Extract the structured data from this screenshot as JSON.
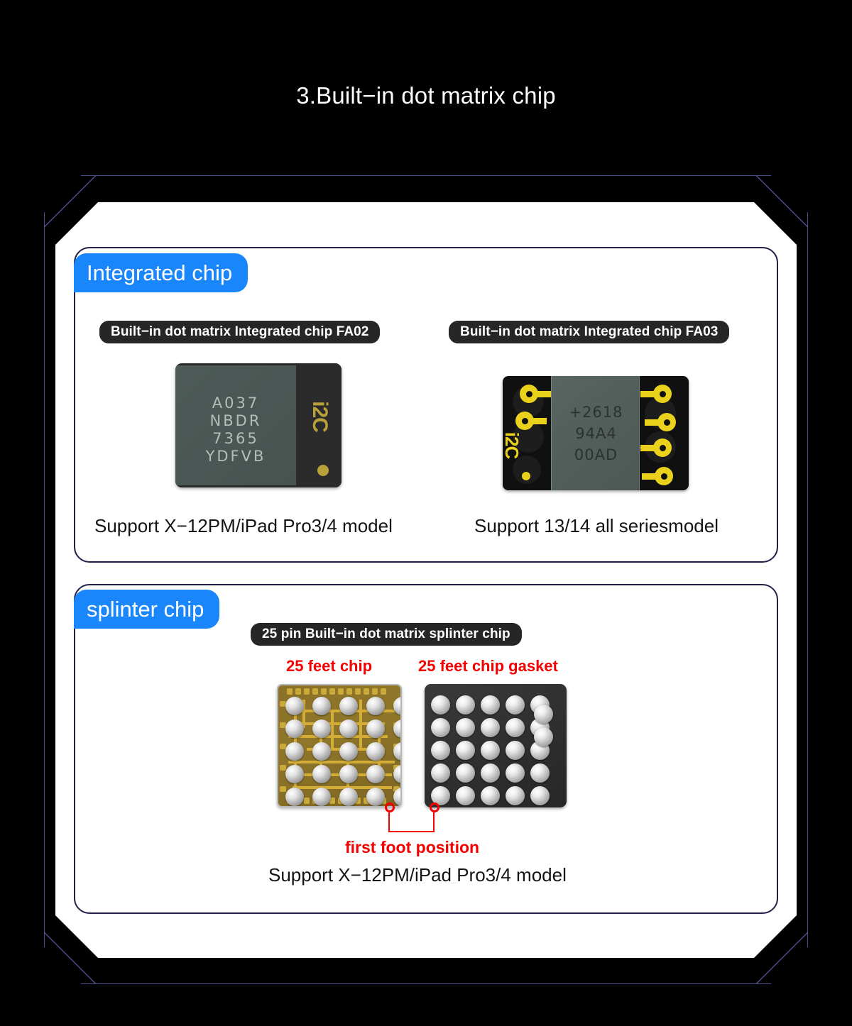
{
  "page": {
    "title": "3.Built−in dot matrix chip",
    "background_color": "#000000",
    "panel_color": "#ffffff",
    "accent_blue": "#1a86fb",
    "accent_red": "#f40000",
    "border_color": "#21214a"
  },
  "sections": [
    {
      "badge": "Integrated chip",
      "items": [
        {
          "pill": "Built−in dot matrix Integrated chip FA02",
          "caption": "Support X−12PM/iPad Pro3/4 model",
          "chip": {
            "die_lines": [
              "A037",
              "NBDR",
              "7365",
              "YDFVB"
            ],
            "brand": "i2C",
            "die_color": "#4a5754",
            "body_color": "#2b2b2b",
            "gold_color": "#b8a03b"
          }
        },
        {
          "pill": "Built−in dot matrix Integrated chip FA03",
          "caption": "Support 13/14 all seriesmodel",
          "chip": {
            "die_lines": [
              "+2618",
              "94A4",
              "00AD"
            ],
            "brand": "i2C",
            "die_color": "#525e5a",
            "body_color": "#101010",
            "gold_color": "#e9d11c"
          }
        }
      ]
    },
    {
      "badge": "splinter chip",
      "pill": "25 pin Built−in dot matrix splinter chip",
      "caption": "Support X−12PM/iPad Pro3/4 model",
      "parts": [
        {
          "label": "25 feet chip",
          "label_color": "#f40000",
          "grid_rows": 5,
          "grid_cols": 5,
          "ball_count": 25,
          "board_color": "#8a7128"
        },
        {
          "label": "25 feet chip gasket",
          "label_color": "#f40000",
          "grid_rows": 5,
          "grid_cols": 5,
          "extra_balls": 2,
          "ball_count": 27,
          "board_color": "#2f2f2f"
        }
      ],
      "annotation": "first foot position"
    }
  ]
}
